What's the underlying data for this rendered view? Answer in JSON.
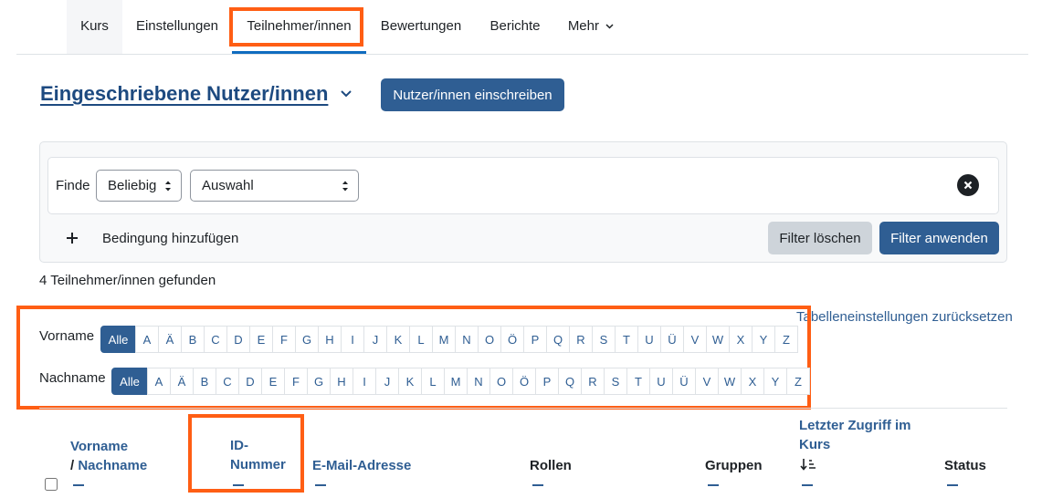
{
  "nav": {
    "tabs": [
      "Kurs",
      "Einstellungen",
      "Teilnehmer/innen",
      "Bewertungen",
      "Berichte",
      "Mehr"
    ]
  },
  "heading": {
    "title": "Eingeschriebene Nutzer/innen",
    "enrol_button": "Nutzer/innen einschreiben"
  },
  "filter": {
    "label": "Finde",
    "match_select": "Beliebig",
    "type_select": "Auswahl",
    "add_condition": "Bedingung hinzufügen",
    "clear_button": "Filter löschen",
    "apply_button": "Filter anwenden"
  },
  "result_count": "4 Teilnehmer/innen gefunden",
  "reset_table": "Tabelleneinstellungen zurücksetzen",
  "initials": {
    "firstname_label": "Vorname",
    "lastname_label": "Nachname",
    "letters": [
      "Alle",
      "A",
      "Ä",
      "B",
      "C",
      "D",
      "E",
      "F",
      "G",
      "H",
      "I",
      "J",
      "K",
      "L",
      "M",
      "N",
      "O",
      "Ö",
      "P",
      "Q",
      "R",
      "S",
      "T",
      "U",
      "Ü",
      "V",
      "W",
      "X",
      "Y",
      "Z"
    ]
  },
  "table": {
    "col_firstname": "Vorname",
    "col_slash": "/",
    "col_lastname": "Nachname",
    "col_id_1": "ID-",
    "col_id_2": "Nummer",
    "col_email": "E-Mail-Adresse",
    "col_roles": "Rollen",
    "col_groups": "Gruppen",
    "col_access_1": "Letzter Zugriff im",
    "col_access_2": "Kurs",
    "col_status": "Status"
  }
}
